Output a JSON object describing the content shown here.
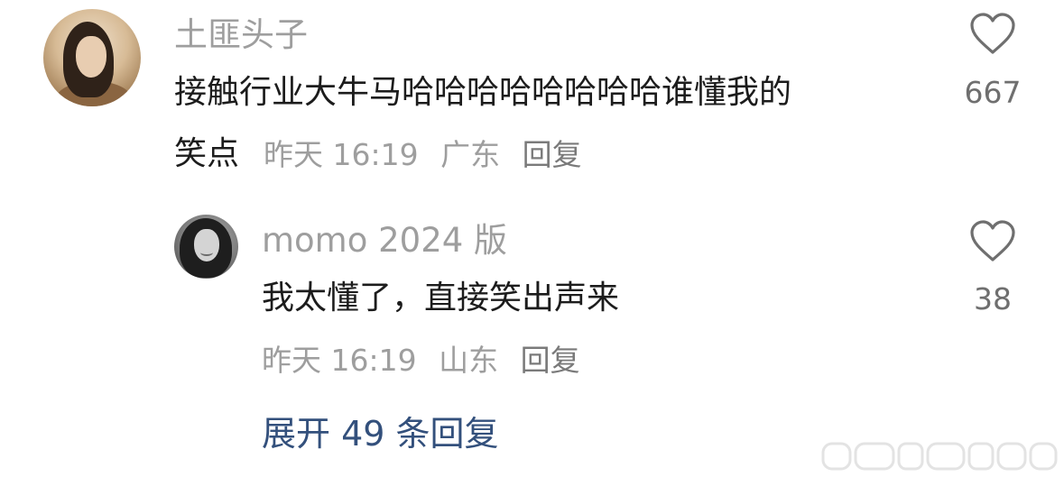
{
  "comment": {
    "username": "土匪头子",
    "text_line1": "接触行业大牛马哈哈哈哈哈哈哈哈谁懂我的",
    "text_line2": "笑点",
    "time": "昨天 16:19",
    "location": "广东",
    "reply_label": "回复",
    "like_count": "667"
  },
  "reply": {
    "username": "momo 2024 版",
    "text": "我太懂了，直接笑出声来",
    "time": "昨天 16:19",
    "location": "山东",
    "reply_label": "回复",
    "like_count": "38"
  },
  "expand_replies_label": "展开 49 条回复",
  "icons": {
    "like": "heart-outline-icon"
  },
  "colors": {
    "link_blue": "#33507c",
    "muted_gray": "#9e9e9e",
    "text_dark": "#1c1c1c"
  }
}
